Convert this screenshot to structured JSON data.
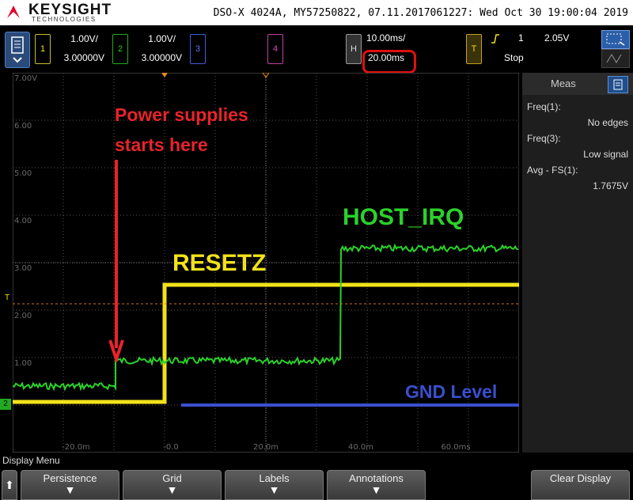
{
  "titlebar": {
    "brand": "KEYSIGHT",
    "brand_sub": "TECHNOLOGIES",
    "info": "DSO-X 4024A, MY57250822, 07.11.2017061227: Wed Oct 30 19:00:04 2019"
  },
  "channels": [
    {
      "num": "1",
      "scale": "1.00V/",
      "offset": "3.00000V",
      "color": "#f2e21a"
    },
    {
      "num": "2",
      "scale": "1.00V/",
      "offset": "3.00000V",
      "color": "#22cc22"
    },
    {
      "num": "3",
      "color": "#3d5bd9"
    },
    {
      "num": "4",
      "color": "#e040c0"
    }
  ],
  "horizontal": {
    "key": "H",
    "scale": "10.00ms/",
    "position": "20.00ms"
  },
  "trigger": {
    "key": "T",
    "source": "1",
    "level": "2.05V",
    "state": "Stop",
    "icon": "rising-edge-icon"
  },
  "plot": {
    "y_ticks": [
      "7.00V",
      "6.00",
      "5.00",
      "4.00",
      "3.00",
      "2.00",
      "1.00"
    ],
    "x_ticks": [
      "-20.0m",
      "-0.0",
      "20.0m",
      "40.0m",
      "60.0ms"
    ],
    "trigger_marker": "T",
    "ground_marker": "2",
    "annotations": {
      "power": "Power supplies starts here",
      "resetz": "RESETZ",
      "host_irq": "HOST_IRQ",
      "gnd": "GND Level"
    },
    "colors": {
      "annot_red": "#e8232a",
      "ch1": "#f2e21a",
      "ch2": "#2bd12b",
      "gnd": "#3a4fd0"
    }
  },
  "meas": {
    "title": "Meas",
    "items": [
      {
        "label": "Freq(1):",
        "value": "No edges"
      },
      {
        "label": "Freq(3):",
        "value": "Low signal"
      },
      {
        "label": "Avg - FS(1):",
        "value": "1.7675V"
      }
    ]
  },
  "softkeys": {
    "menu_title": "Display Menu",
    "keys": [
      {
        "label": "Persistence"
      },
      {
        "label": "Grid"
      },
      {
        "label": "Labels"
      },
      {
        "label": "Annotations"
      }
    ],
    "clear": "Clear Display"
  }
}
